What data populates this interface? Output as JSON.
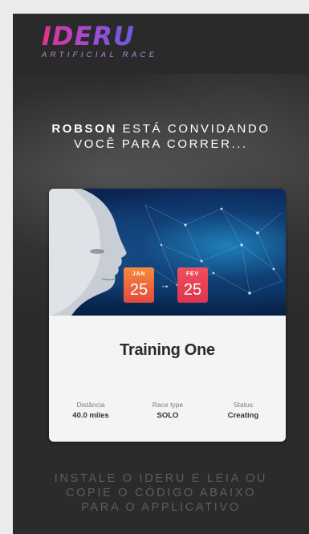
{
  "brand": {
    "logo": "IDERU",
    "tagline": "ARTIFICIAL RACE",
    "colors": {
      "logo_start": "#e0338a",
      "logo_end": "#6a5be0",
      "background": "#2b2b2b"
    }
  },
  "invite": {
    "inviter": "ROBSON",
    "line1_rest": " ESTÁ CONVIDANDO",
    "line2": "VOCÊ PARA CORRER..."
  },
  "race": {
    "title": "Training One",
    "start": {
      "month": "JAN",
      "day": "25"
    },
    "end": {
      "month": "FEV",
      "day": "25"
    },
    "arrow": "→",
    "stats": [
      {
        "label": "Distância",
        "value": "40.0 miles"
      },
      {
        "label": "Race type",
        "value": "SOLO"
      },
      {
        "label": "Status",
        "value": "Creating"
      }
    ]
  },
  "footer": {
    "line1": "INSTALE O IDERU E LEIA OU",
    "line2": "COPIE O CÓDIGO ABAIXO",
    "line3": "PARA O APPLICATIVO"
  }
}
